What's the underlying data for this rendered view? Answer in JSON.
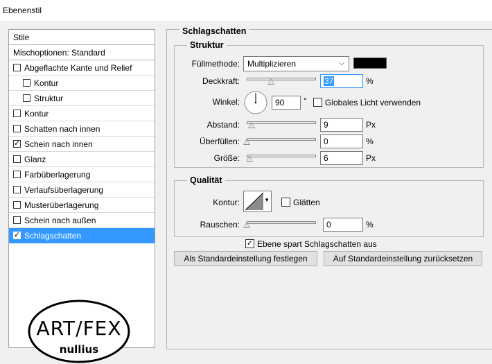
{
  "window": {
    "title": "Ebenenstil"
  },
  "styles_list": {
    "header": "Stile",
    "blend_options": "Mischoptionen: Standard",
    "items": [
      {
        "label": "Abgeflachte Kante und Relief",
        "checked": false,
        "indent": false
      },
      {
        "label": "Kontur",
        "checked": false,
        "indent": true
      },
      {
        "label": "Struktur",
        "checked": false,
        "indent": true
      },
      {
        "label": "Kontur",
        "checked": false,
        "indent": false
      },
      {
        "label": "Schatten nach innen",
        "checked": false,
        "indent": false
      },
      {
        "label": "Schein nach innen",
        "checked": true,
        "indent": false
      },
      {
        "label": "Glanz",
        "checked": false,
        "indent": false
      },
      {
        "label": "Farbüberlagerung",
        "checked": false,
        "indent": false
      },
      {
        "label": "Verlaufsüberlagerung",
        "checked": false,
        "indent": false
      },
      {
        "label": "Musterüberlagerung",
        "checked": false,
        "indent": false
      },
      {
        "label": "Schein nach außen",
        "checked": false,
        "indent": false
      },
      {
        "label": "Schlagschatten",
        "checked": true,
        "indent": false,
        "selected": true
      }
    ],
    "check_glyph": "☑",
    "logo_text_top": "ART / FEX",
    "logo_text_bottom": "nullius"
  },
  "drop_shadow": {
    "title": "Schlagschatten",
    "structure": {
      "title": "Struktur",
      "blend_mode_label": "Füllmethode:",
      "blend_mode_value": "Multiplizieren",
      "shadow_color": "#000000",
      "opacity_label": "Deckkraft:",
      "opacity_value": "37",
      "opacity_unit": "%",
      "angle_label": "Winkel:",
      "angle_value": "90",
      "angle_unit": "°",
      "global_light_label": "Globales Licht verwenden",
      "global_light_checked": false,
      "distance_label": "Abstand:",
      "distance_value": "9",
      "distance_unit": "Px",
      "spread_label": "Überfüllen:",
      "spread_value": "0",
      "spread_unit": "%",
      "size_label": "Größe:",
      "size_value": "6",
      "size_unit": "Px"
    },
    "quality": {
      "title": "Qualität",
      "contour_label": "Kontur:",
      "antialias_label": "Glätten",
      "antialias_checked": false,
      "noise_label": "Rauschen:",
      "noise_value": "0",
      "noise_unit": "%"
    },
    "knockout_label": "Ebene spart Schlagschatten aus",
    "knockout_checked": true,
    "make_default_button": "Als Standardeinstellung festlegen",
    "reset_default_button": "Auf Standardeinstellung zurücksetzen"
  }
}
